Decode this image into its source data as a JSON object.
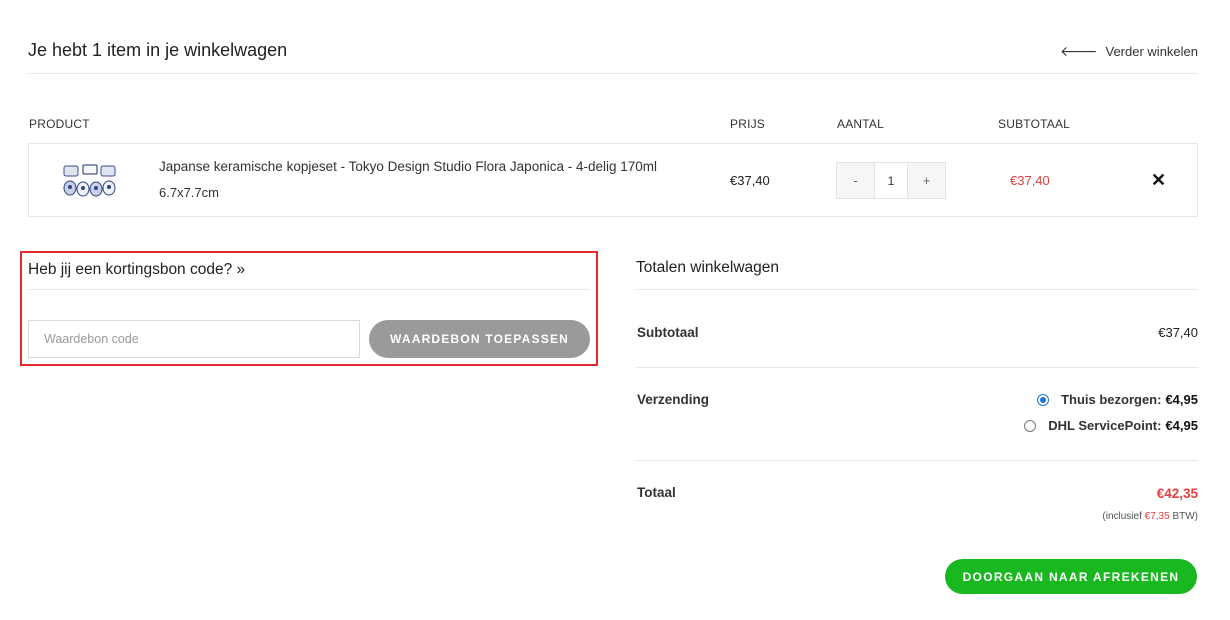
{
  "header": {
    "title": "Je hebt 1 item in je winkelwagen",
    "continue_label": "Verder winkelen"
  },
  "columns": {
    "product": "PRODUCT",
    "price": "PRIJS",
    "quantity": "AANTAL",
    "subtotal": "SUBTOTAAL"
  },
  "item": {
    "name": "Japanse keramische kopjeset - Tokyo Design Studio Flora Japonica - 4-delig 170ml",
    "size": "6.7x7.7cm",
    "price": "€37,40",
    "qty_minus": "-",
    "qty": "1",
    "qty_plus": "+",
    "subtotal": "€37,40",
    "remove": "✕"
  },
  "coupon": {
    "title": "Heb jij een kortingsbon code? »",
    "placeholder": "Waardebon code",
    "button_label": "WAARDEBON TOEPASSEN"
  },
  "totals": {
    "title": "Totalen winkelwagen",
    "subtotal_label": "Subtotaal",
    "subtotal_value": "€37,40",
    "shipping_label": "Verzending",
    "shipping_options": [
      {
        "label": "Thuis bezorgen:",
        "price": "€4,95",
        "selected": true
      },
      {
        "label": "DHL ServicePoint:",
        "price": "€4,95",
        "selected": false
      }
    ],
    "total_label": "Totaal",
    "total_value": "€42,35",
    "tax_prefix": "(inclusief",
    "tax_amount": "€7,35",
    "tax_suffix": "BTW)"
  },
  "checkout": {
    "button_label": "DOORGAAN NAAR AFREKENEN"
  },
  "colors": {
    "accent_red": "#e2403c",
    "checkout_green": "#19b821",
    "highlight_border": "#e12b2b",
    "radio_blue": "#1a73e8"
  }
}
